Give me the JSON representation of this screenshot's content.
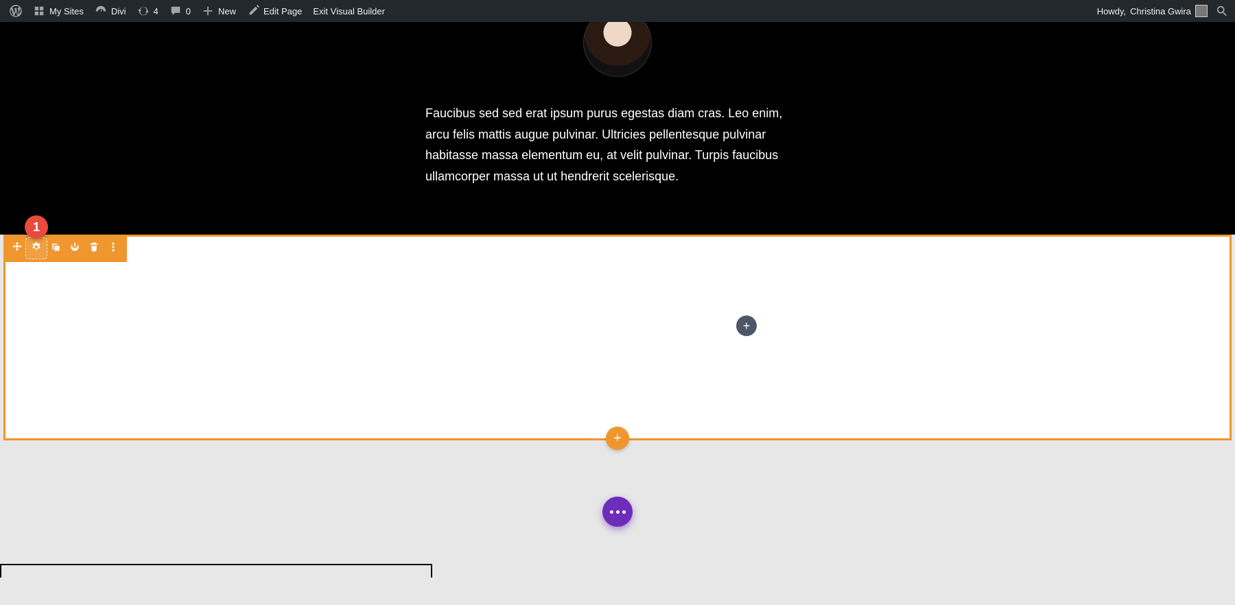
{
  "adminbar": {
    "my_sites": "My Sites",
    "site_name": "Divi",
    "updates": "4",
    "comments": "0",
    "new": "New",
    "edit_page": "Edit Page",
    "exit_vb": "Exit Visual Builder",
    "howdy_prefix": "Howdy, ",
    "user_name": "Christina Gwira"
  },
  "testimonial": {
    "body": "Faucibus sed sed erat ipsum purus egestas diam cras. Leo enim, arcu felis mattis augue pulvinar. Ultricies pellentesque pulvinar habitasse massa elementum eu, at velit pulvinar. Turpis faucibus ullamcorper massa ut ut hendrerit scelerisque."
  },
  "add_glyph": "+",
  "annotation": {
    "number": "1"
  },
  "colors": {
    "section_accent": "#f0962e",
    "fab": "#6c2eb9",
    "module_add": "#4c5866",
    "anno": "#e84a3d"
  }
}
